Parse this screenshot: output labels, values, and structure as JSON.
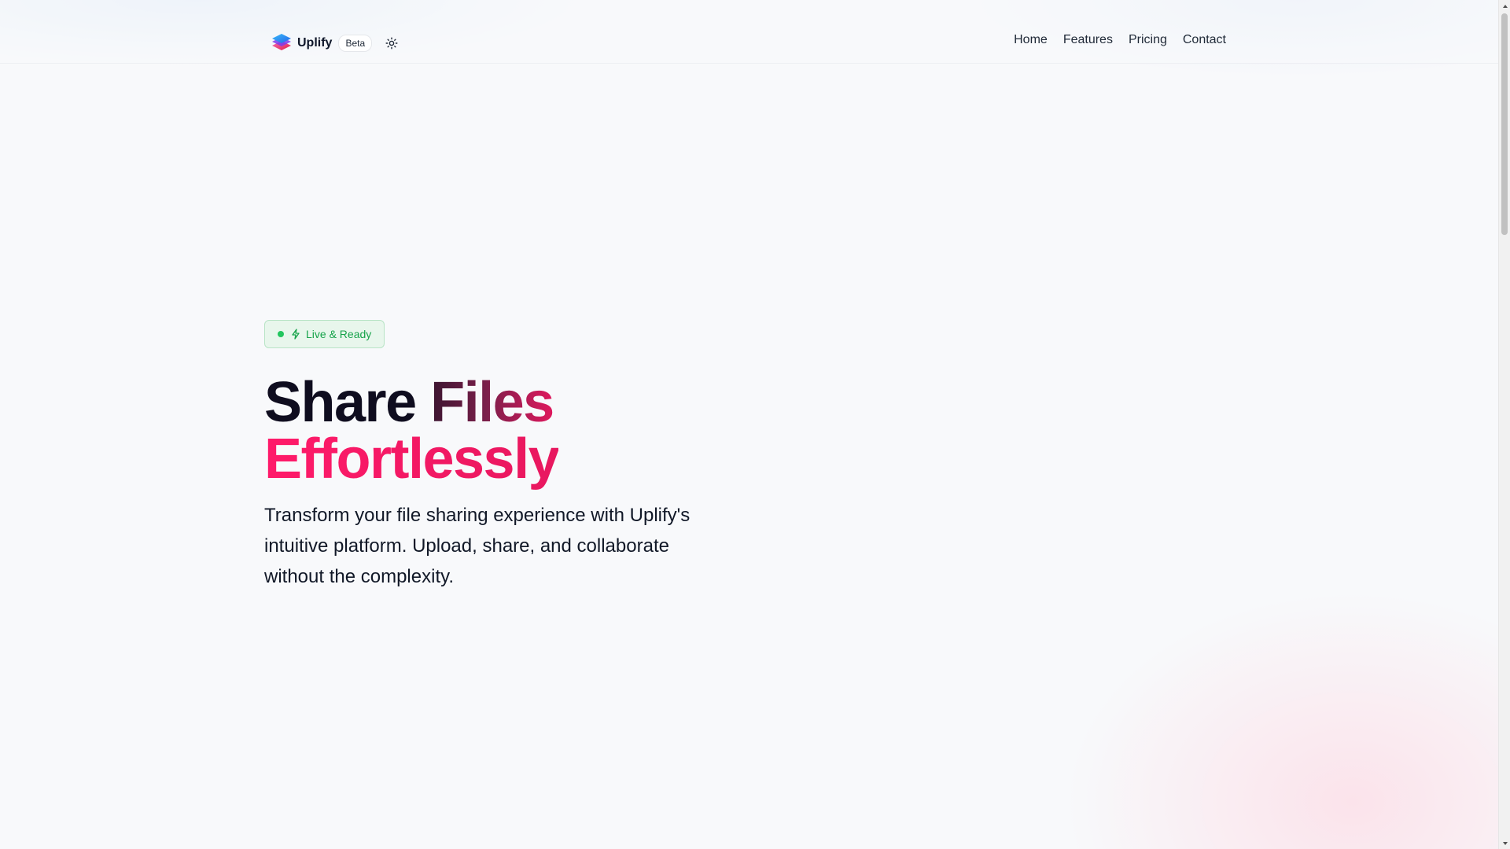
{
  "header": {
    "brand_name": "Uplify",
    "badge": "Beta",
    "theme_toggle_icon": "sun-icon",
    "nav": [
      {
        "label": "Home"
      },
      {
        "label": "Features"
      },
      {
        "label": "Pricing"
      },
      {
        "label": "Contact"
      }
    ]
  },
  "hero": {
    "status_label": "Live & Ready",
    "status_icon": "bolt-icon",
    "title_word_1": "Share",
    "title_word_2": "Files",
    "title_word_3": "Effortlessly",
    "subtitle": "Transform your file sharing experience with Uplify's intuitive platform. Upload, share, and collaborate without the complexity."
  },
  "colors": {
    "accent": "#e8185f",
    "status_green": "#16a34a",
    "status_bg": "#e8f6ec",
    "text_dark": "#0f172a"
  }
}
